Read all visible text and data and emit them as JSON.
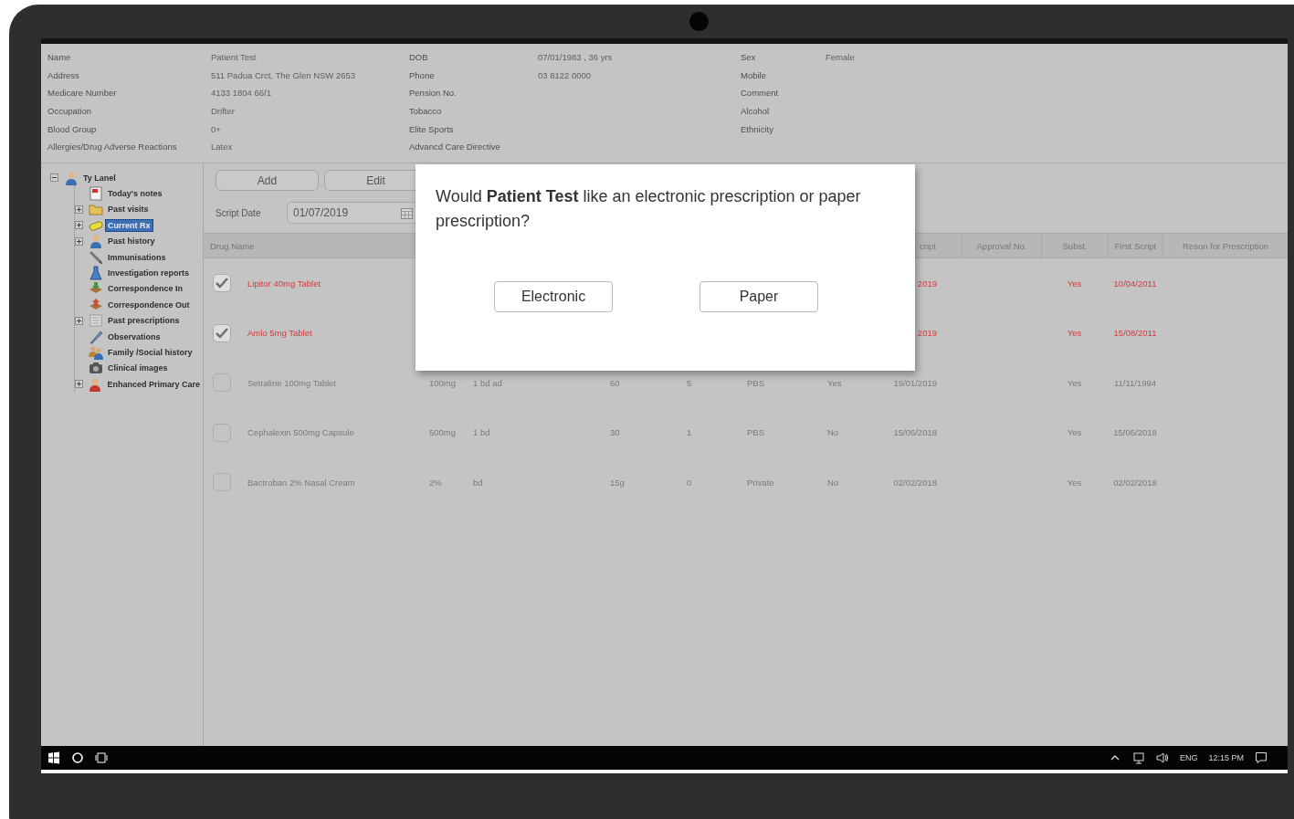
{
  "patient_details": {
    "rows": [
      [
        {
          "label": "Name",
          "value": "Patient Test"
        },
        {
          "label": "DOB",
          "value": "07/01/1983 , 36 yrs"
        },
        {
          "label": "Sex",
          "value": "Female"
        }
      ],
      [
        {
          "label": "Address",
          "value": "511 Padua Crct, The Glen NSW  2653"
        },
        {
          "label": "Phone",
          "value": "03 8122 0000"
        },
        {
          "label": "Mobile"
        }
      ],
      [
        {
          "label": "Medicare Number",
          "value": "4133 1804  66/1"
        },
        {
          "label": "Pension No."
        },
        {
          "label": "Comment"
        }
      ],
      [
        {
          "label": "Occupation",
          "value": "Drifter"
        },
        {
          "label": "Tobacco"
        },
        {
          "label": "Alcohol"
        }
      ],
      [
        {
          "label": "Blood Group",
          "value": "0+"
        },
        {
          "label": "Elite Sports"
        },
        {
          "label": "Ethnicity"
        }
      ],
      [
        {
          "label": "Allergies/Drug Adverse Reactions",
          "value": "Latex"
        },
        {
          "label": "Advancd Care Directive"
        }
      ]
    ]
  },
  "tree": {
    "label": "Ty Lanel",
    "expanded": true,
    "selected": false,
    "children": [
      {
        "label": "Today's notes",
        "selected": false
      },
      {
        "label": "Past visits",
        "expanded": false,
        "selected": false
      },
      {
        "label": "Current Rx",
        "expanded": false,
        "selected": true
      },
      {
        "label": "Past history",
        "expanded": false,
        "selected": false
      },
      {
        "label": "Immunisations",
        "selected": false
      },
      {
        "label": "Investigation reports",
        "selected": false
      },
      {
        "label": "Correspondence In",
        "selected": false
      },
      {
        "label": "Correspondence Out",
        "selected": false
      },
      {
        "label": "Past prescriptions",
        "expanded": false,
        "selected": false
      },
      {
        "label": "Observations",
        "selected": false
      },
      {
        "label": "Family /Social history",
        "selected": false
      },
      {
        "label": "Clinical images",
        "selected": false
      },
      {
        "label": "Enhanced Primary Care",
        "expanded": false,
        "selected": false
      }
    ]
  },
  "toolbar": {
    "buttons": [
      "Add",
      "Edit"
    ]
  },
  "script_date": {
    "label": "Script Date",
    "value": "01/07/2019"
  },
  "table": {
    "columns": {
      "drug_name": "Drug Name",
      "column_8": "cript",
      "approval_no": "Approval No.",
      "subst": "Subst.",
      "first_script": "First Script",
      "reason": "Reson for Prescription"
    },
    "rows": [
      {
        "checked": true,
        "alert": true,
        "cells": {
          "drug_name": "Lipitor 40mg Tablet",
          "column_8": "2019",
          "subst": "Yes",
          "first_script": "10/04/2011"
        }
      },
      {
        "checked": true,
        "alert": true,
        "cells": {
          "drug_name": "Amlo 5mg Tablet",
          "column_8": "2019",
          "subst": "Yes",
          "first_script": "15/08/2011"
        }
      },
      {
        "checked": false,
        "alert": false,
        "cells": {
          "drug_name": "Setraline 100mg Tablet",
          "column_3": "100mg",
          "column_4": "1 bd ad",
          "column_5": "60",
          "column_6": "5",
          "column_7": "PBS",
          "column_8_yes_no": "Yes",
          "column_8": "19/01/2019",
          "subst": "Yes",
          "first_script": "11/11/1994"
        }
      },
      {
        "checked": false,
        "alert": false,
        "cells": {
          "drug_name": "Cephalexin 500mg Capsule",
          "column_3": "500mg",
          "column_4": "1 bd",
          "column_5": "30",
          "column_6": "1",
          "column_7": "PBS",
          "column_8_yes_no": "No",
          "column_8": "15/06/2018",
          "subst": "Yes",
          "first_script": "15/06/2018"
        }
      },
      {
        "checked": false,
        "alert": false,
        "cells": {
          "drug_name": "Bactroban 2% Nasal Cream",
          "column_3": "2%",
          "column_4": "bd",
          "column_5": "15g",
          "column_6": "0",
          "column_7": "Private",
          "column_8_yes_no": "No",
          "column_8": "02/02/2018",
          "subst": "Yes",
          "first_script": "02/02/2018"
        }
      }
    ]
  },
  "dialog": {
    "message": "Would **Patient Test** like an electronic prescription or paper prescription?",
    "buttons": [
      "Electronic",
      "Paper"
    ]
  },
  "taskbar": {
    "language": "ENG",
    "time": "12:15 PM"
  }
}
